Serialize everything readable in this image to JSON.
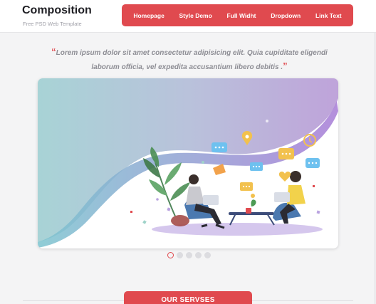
{
  "colors": {
    "accent": "#e04a4f",
    "text_dark": "#1f1f24",
    "text_muted": "#8d8d94"
  },
  "header": {
    "logo": "Composition",
    "tagline": "Free PSD Web Template",
    "nav": [
      "Homepage",
      "Style Demo",
      "Full Widht",
      "Dropdown",
      "Link Text"
    ]
  },
  "quote": {
    "open_mark": "“",
    "text": "Lorem ipsum dolor sit amet consectetur adipisicing elit. Quia cupiditate eligendi laborum officia, vel expedita accusantium libero debitis .",
    "close_mark": "”"
  },
  "slider": {
    "illustration": "two-people-working-on-laptops",
    "slide_count": 5,
    "active_index": 0
  },
  "section": {
    "button_label": "OUR SERVSES"
  }
}
